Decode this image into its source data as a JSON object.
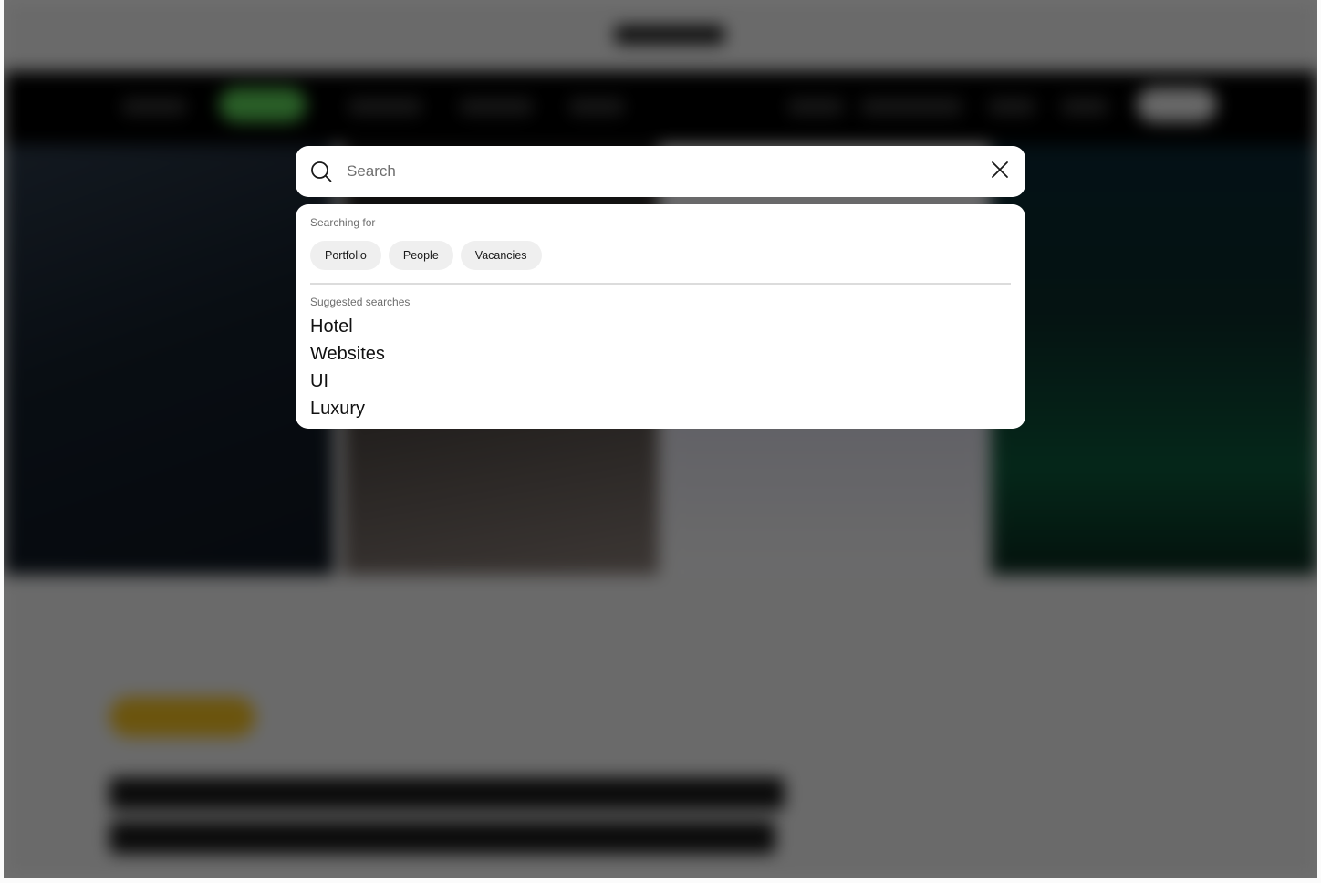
{
  "search": {
    "placeholder": "Search",
    "value": ""
  },
  "filters": {
    "heading": "Searching for",
    "chips": [
      {
        "label": "Portfolio"
      },
      {
        "label": "People"
      },
      {
        "label": "Vacancies"
      }
    ]
  },
  "suggested": {
    "heading": "Suggested searches",
    "items": [
      {
        "label": "Hotel"
      },
      {
        "label": "Websites"
      },
      {
        "label": "UI"
      },
      {
        "label": "Luxury"
      }
    ]
  },
  "icons": {
    "search": "search-icon",
    "close": "close-icon"
  },
  "colors": {
    "overlay": "#000000",
    "panel": "#ffffff",
    "chip_bg": "#efefef",
    "nav_accent": "#5fd65a",
    "tag_accent": "#f4c020"
  }
}
